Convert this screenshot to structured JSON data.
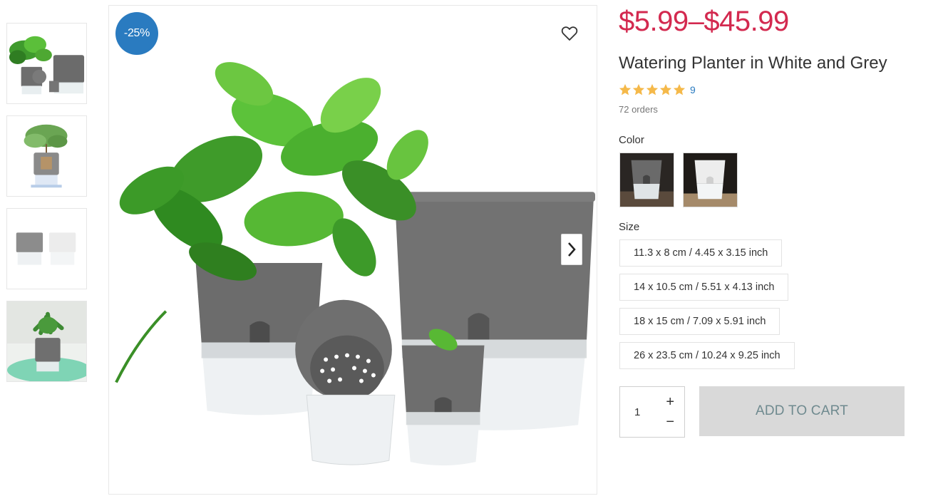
{
  "product": {
    "discount_badge": "-25%",
    "price_range": "$5.99–$45.99",
    "title": "Watering Planter in White and Grey",
    "rating_stars": 5,
    "review_count": "9",
    "orders": "72 orders"
  },
  "options": {
    "color_label": "Color",
    "size_label": "Size",
    "sizes": [
      "11.3 x 8 cm / 4.45 x 3.15 inch",
      "14 x 10.5 cm / 5.51 x 4.13 inch",
      "18 x 15 cm / 7.09 x 5.91 inch",
      "26 x 23.5 cm / 10.24 x 9.25 inch"
    ]
  },
  "cart": {
    "quantity": "1",
    "plus": "+",
    "minus": "−",
    "add_label": "ADD TO CART"
  },
  "colors": {
    "price": "#d3294f",
    "badge": "#2a7bc0",
    "star": "#f5b94a",
    "link": "#2a7bc0",
    "button_bg": "#d9d9d9",
    "button_text": "#6f8a8f"
  },
  "icons": {
    "wishlist": "heart-icon",
    "prev": "chevron-left-icon",
    "next": "chevron-right-icon",
    "star": "star-icon"
  }
}
